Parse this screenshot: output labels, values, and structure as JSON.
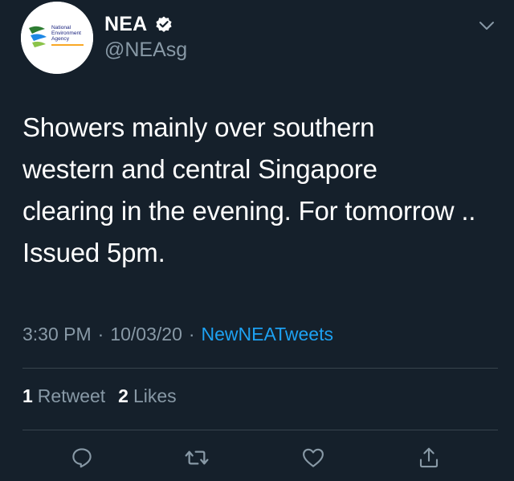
{
  "author": {
    "display_name": "NEA",
    "handle": "@NEAsg",
    "verified": true,
    "avatar_logo_text": [
      "National",
      "Environment",
      "Agency"
    ]
  },
  "tweet": {
    "text": "Showers mainly over southern\nwestern and central Singapore\nclearing in the evening. For tomorrow ..\nIssued 5pm.",
    "time": "3:30 PM",
    "date": "10/03/20",
    "separator": "·",
    "source": "NewNEATweets"
  },
  "stats": {
    "retweets_count": "1",
    "retweets_label": "Retweet",
    "likes_count": "2",
    "likes_label": "Likes"
  },
  "icons": {
    "menu": "chevron-down-icon",
    "verified": "verified-badge-icon",
    "reply": "reply-icon",
    "retweet": "retweet-icon",
    "like": "heart-icon",
    "share": "share-icon"
  },
  "colors": {
    "background": "#15202b",
    "text_primary": "#ffffff",
    "text_secondary": "#8899a6",
    "link": "#1da1f2",
    "divider": "#38444d"
  }
}
